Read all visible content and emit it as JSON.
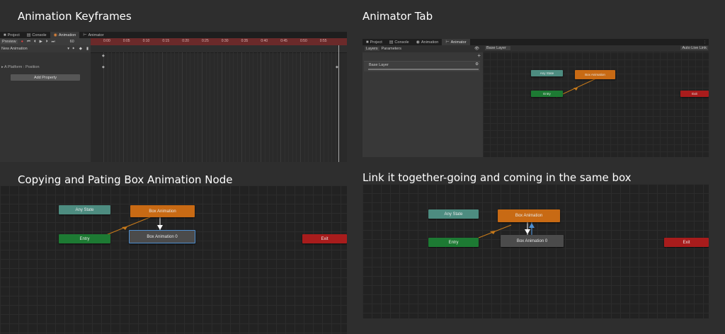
{
  "captions": {
    "top_left": "Animation Keyframes",
    "top_right": "Animator Tab",
    "bottom_left": "Copying and Pating Box Animation Node",
    "bottom_right": "Link it together-going and coming in the same box"
  },
  "editor_tabs": [
    "Project",
    "Console",
    "Animation",
    "Animator"
  ],
  "animation": {
    "preview_label": "Preview",
    "frame_value": "60",
    "clip_name": "New Animation",
    "property_label": "A Platform : Position",
    "add_property_label": "Add Property",
    "timeline_ticks": [
      "0:00",
      "0:05",
      "0:10",
      "0:15",
      "0:20",
      "0:25",
      "0:30",
      "0:35",
      "0:40",
      "0:45",
      "0:50",
      "0:55"
    ]
  },
  "animator": {
    "layers_tab": "Layers",
    "parameters_tab": "Parameters",
    "layer_name": "Base Layer",
    "breadcrumb": "Base Layer",
    "auto_live_link": "Auto Live Link"
  },
  "nodes": {
    "any_state": "Any State",
    "entry": "Entry",
    "box_animation": "Box Animation",
    "box_animation_0": "Box Animation 0",
    "exit": "Exit"
  },
  "colors": {
    "any_state": "#4d8c80",
    "entry": "#1d7a33",
    "box_animation": "#c86a14",
    "exit": "#a81c1c",
    "box_animation_0": "#4b4b4b",
    "transition": "#c87a1a",
    "selection": "#4f8fd0",
    "recording_red": "#7a2b2b"
  }
}
